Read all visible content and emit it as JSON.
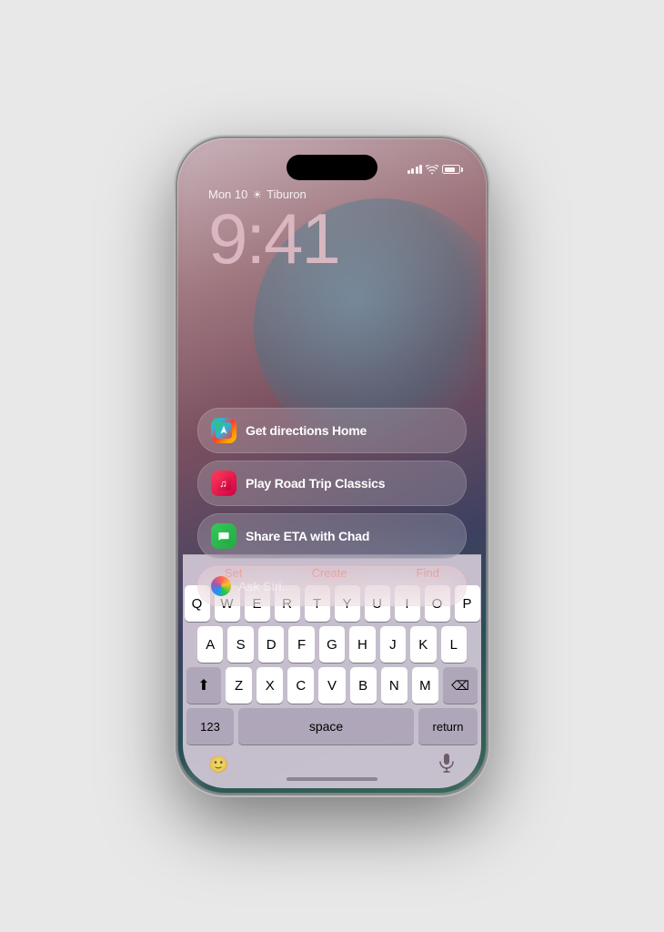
{
  "phone": {
    "background_gradient": "linear-gradient(160deg, #c8b0b8, #a07880, #7a5060, #3d4060, #2a5055, #3a6858)"
  },
  "status_bar": {
    "signal_label": "signal",
    "wifi_label": "wifi",
    "battery_label": "battery"
  },
  "clock": {
    "date": "Mon 10",
    "location": "Tiburon",
    "time": "9:41"
  },
  "suggestions": [
    {
      "id": "directions",
      "icon_type": "maps",
      "text": "Get directions Home"
    },
    {
      "id": "music",
      "icon_type": "music",
      "text": "Play Road Trip Classics"
    },
    {
      "id": "messages",
      "icon_type": "messages",
      "text": "Share ETA with Chad"
    }
  ],
  "siri_bar": {
    "placeholder": "Ask Siri..."
  },
  "quick_actions": {
    "set": "Set",
    "create": "Create",
    "find": "Find"
  },
  "keyboard": {
    "rows": [
      [
        "Q",
        "W",
        "E",
        "R",
        "T",
        "Y",
        "U",
        "I",
        "O",
        "P"
      ],
      [
        "A",
        "S",
        "D",
        "F",
        "G",
        "H",
        "J",
        "K",
        "L"
      ],
      [
        "⇧",
        "Z",
        "X",
        "C",
        "V",
        "B",
        "N",
        "M",
        "⌫"
      ],
      [
        "123",
        "space",
        "return"
      ]
    ]
  },
  "bottom_bar": {
    "emoji_icon": "emoji",
    "mic_icon": "microphone"
  }
}
